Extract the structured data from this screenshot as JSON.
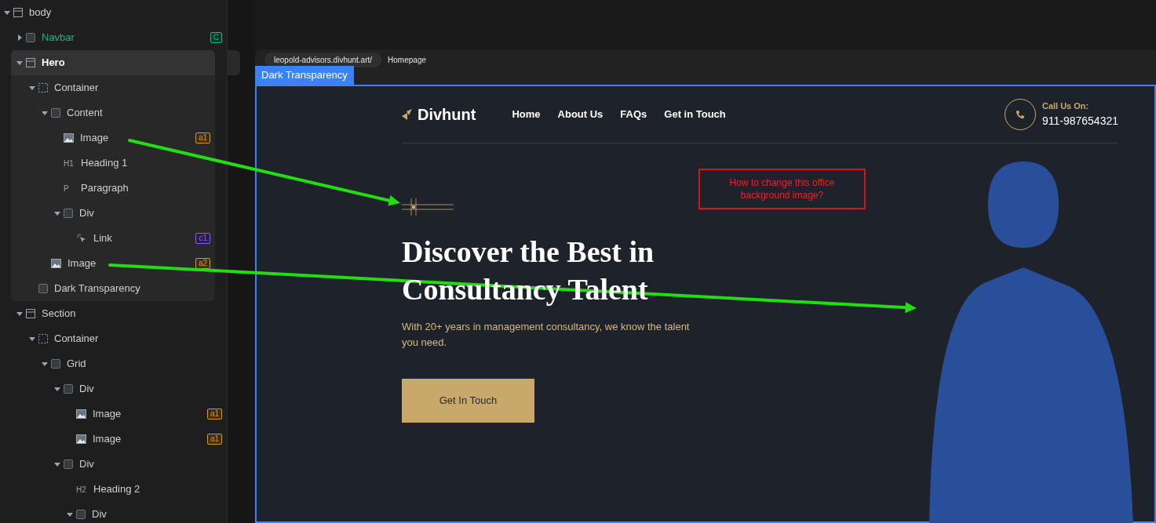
{
  "navigator": {
    "tree": [
      {
        "label": "body",
        "kind": "section",
        "expanded": true,
        "children": [
          {
            "label": "Navbar",
            "kind": "component",
            "expanded": false,
            "selected": false,
            "badge": {
              "text": "C",
              "color": "#10b981"
            }
          },
          {
            "label": "Hero",
            "kind": "section",
            "expanded": true,
            "selected": true,
            "children": [
              {
                "label": "Container",
                "kind": "container",
                "expanded": true,
                "children": [
                  {
                    "label": "Content",
                    "kind": "box",
                    "expanded": true,
                    "children": [
                      {
                        "label": "Image",
                        "kind": "image",
                        "badge": {
                          "text": "a1",
                          "color": "#d49a1c"
                        }
                      },
                      {
                        "label": "Heading 1",
                        "kind": "tag",
                        "tag": "H1"
                      },
                      {
                        "label": "Paragraph",
                        "kind": "tag",
                        "tag": "P"
                      },
                      {
                        "label": "Div",
                        "kind": "box",
                        "expanded": true,
                        "children": [
                          {
                            "label": "Link",
                            "kind": "link",
                            "badge": {
                              "text": "c1",
                              "color": "#8b5cf6"
                            }
                          }
                        ]
                      }
                    ]
                  },
                  {
                    "label": "Image",
                    "kind": "image",
                    "badge": {
                      "text": "a2",
                      "color": "#d49a1c"
                    }
                  }
                ]
              },
              {
                "label": "Dark Transparency",
                "kind": "box"
              }
            ]
          },
          {
            "label": "Section",
            "kind": "section",
            "expanded": true,
            "selected": false,
            "children": [
              {
                "label": "Container",
                "kind": "container",
                "expanded": true,
                "children": [
                  {
                    "label": "Grid",
                    "kind": "box",
                    "expanded": true,
                    "children": [
                      {
                        "label": "Div",
                        "kind": "box",
                        "expanded": true,
                        "children": [
                          {
                            "label": "Image",
                            "kind": "image",
                            "badge": {
                              "text": "a1",
                              "color": "#d49a1c"
                            }
                          },
                          {
                            "label": "Image",
                            "kind": "image",
                            "badge": {
                              "text": "a1",
                              "color": "#d49a1c"
                            }
                          }
                        ]
                      },
                      {
                        "label": "Div",
                        "kind": "box",
                        "expanded": true,
                        "children": [
                          {
                            "label": "Heading 2",
                            "kind": "tag",
                            "tag": "H2"
                          },
                          {
                            "label": "Div",
                            "kind": "box",
                            "expanded": true
                          }
                        ]
                      }
                    ]
                  }
                ]
              }
            ]
          }
        ]
      }
    ]
  },
  "preview": {
    "url": "leopold-advisors.divhunt.art/",
    "page": "Homepage",
    "selection_label": "Dark Transparency",
    "site": {
      "logo": "Divhunt",
      "nav": [
        "Home",
        "About Us",
        "FAQs",
        "Get in Touch"
      ],
      "call_label": "Call Us On:",
      "phone": "911-987654321",
      "heading": "Discover the Best in Consultancy Talent",
      "text": "With 20+ years in management consultancy, we know the talent you need.",
      "button": "Get In Touch"
    }
  },
  "annotation": {
    "note": "How to change this office background image?"
  }
}
